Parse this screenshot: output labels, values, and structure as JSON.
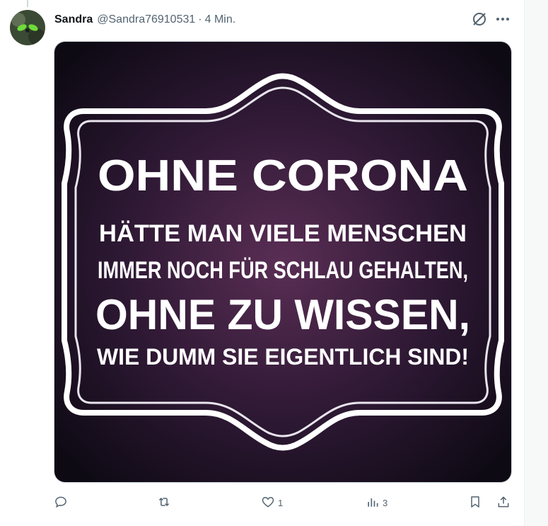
{
  "author": {
    "name": "Sandra",
    "handle": "@Sandra76910531",
    "separator": "·",
    "time": "4 Min."
  },
  "media": {
    "lines": [
      "OHNE CORONA",
      "HÄTTE MAN VIELE MENSCHEN",
      "IMMER NOCH FÜR SCHLAU GEHALTEN,",
      "OHNE ZU WISSEN,",
      "WIE DUMM SIE EIGENTLICH SIND!"
    ]
  },
  "actions": {
    "reply_count": "",
    "retweet_count": "",
    "like_count": "1",
    "views_count": "3"
  },
  "icons": {
    "grok": "grok-icon",
    "more": "more-icon",
    "reply": "reply-icon",
    "retweet": "retweet-icon",
    "like": "heart-icon",
    "views": "views-icon",
    "bookmark": "bookmark-icon",
    "share": "share-icon"
  },
  "colors": {
    "text_primary": "#0f1419",
    "text_secondary": "#536471",
    "image_background": "#2a1630",
    "frame": "#ffffff"
  }
}
